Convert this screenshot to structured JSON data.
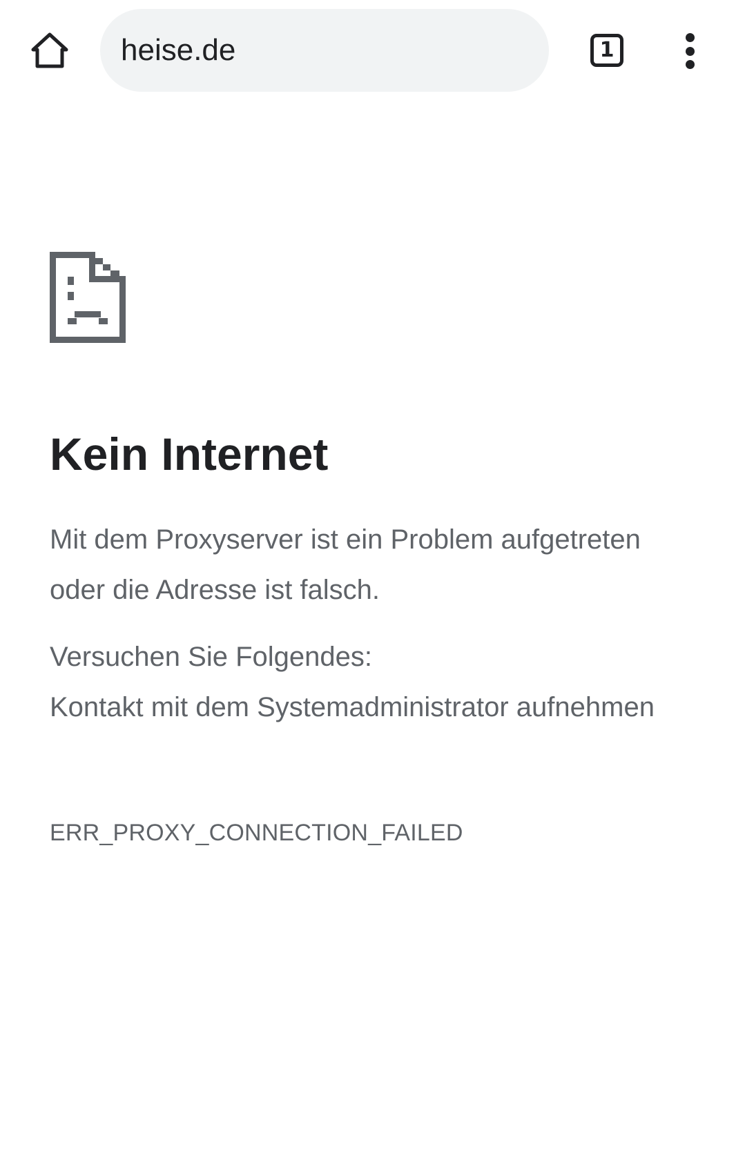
{
  "toolbar": {
    "home_icon": "home-icon",
    "url": "heise.de",
    "tab_count": "1",
    "menu_icon": "more-vert-icon"
  },
  "error": {
    "icon": "sad-page-icon",
    "title": "Kein Internet",
    "description": "Mit dem Proxyserver ist ein Problem aufgetreten oder die Adresse ist falsch.",
    "suggestions_heading": "Versuchen Sie Folgendes:",
    "suggestions": [
      "Kontakt mit dem Systemadministrator aufnehmen"
    ],
    "code": "ERR_PROXY_CONNECTION_FAILED"
  },
  "colors": {
    "title": "#202124",
    "body_text": "#5f6368",
    "icon": "#5f6368",
    "omnibox_bg": "#f1f3f4"
  }
}
